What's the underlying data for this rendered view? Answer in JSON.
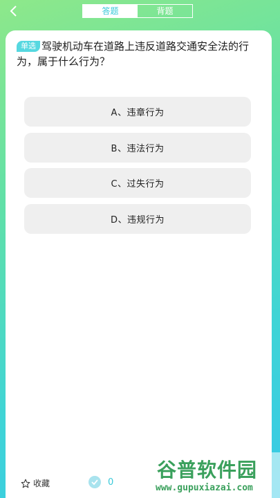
{
  "header": {
    "tabs": [
      {
        "label": "答题",
        "active": true
      },
      {
        "label": "背题",
        "active": false
      }
    ]
  },
  "question": {
    "type_badge": "单选",
    "text": "驾驶机动车在道路上违反道路交通安全法的行为，属于什么行为？"
  },
  "options": [
    {
      "label": "A、违章行为"
    },
    {
      "label": "B、违法行为"
    },
    {
      "label": "C、过失行为"
    },
    {
      "label": "D、违规行为"
    }
  ],
  "footer": {
    "favorite_label": "收藏",
    "correct_count": "0"
  },
  "watermark": {
    "title": "谷普软件园",
    "url": "www.gupuxiazai.com"
  },
  "colors": {
    "accent": "#38c9d9",
    "badge": "#56d8e0",
    "option_bg": "#efefef",
    "watermark_green": "#3aa05c"
  }
}
